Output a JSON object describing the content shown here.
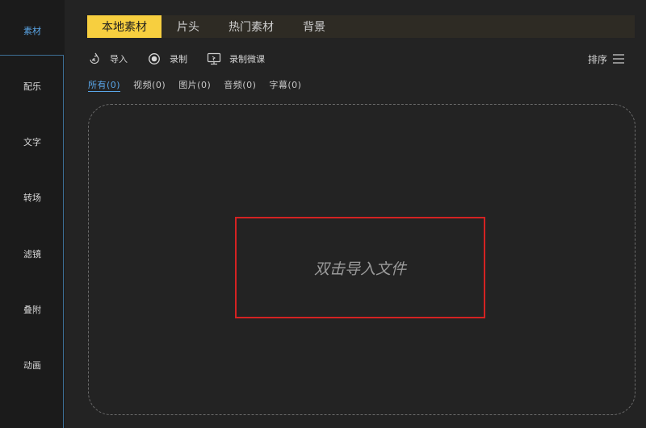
{
  "sidebar": {
    "items": [
      {
        "label": "素材",
        "active": true
      },
      {
        "label": "配乐"
      },
      {
        "label": "文字"
      },
      {
        "label": "转场"
      },
      {
        "label": "滤镜"
      },
      {
        "label": "叠附"
      },
      {
        "label": "动画"
      }
    ]
  },
  "tabs": [
    {
      "label": "本地素材",
      "active": true
    },
    {
      "label": "片头"
    },
    {
      "label": "热门素材"
    },
    {
      "label": "背景"
    }
  ],
  "toolbar": {
    "import_label": "导入",
    "record_label": "录制",
    "record_lesson_label": "录制微课",
    "sort_label": "排序"
  },
  "filters": [
    {
      "label": "所有(0)",
      "active": true
    },
    {
      "label": "视频(0)"
    },
    {
      "label": "图片(0)"
    },
    {
      "label": "音频(0)"
    },
    {
      "label": "字幕(0)"
    }
  ],
  "dropzone": {
    "hint": "双击导入文件"
  },
  "colors": {
    "accent_blue": "#5aa6e8",
    "active_tab_yellow": "#f7cf3f",
    "highlight_red": "#d42222",
    "background": "#232323"
  }
}
